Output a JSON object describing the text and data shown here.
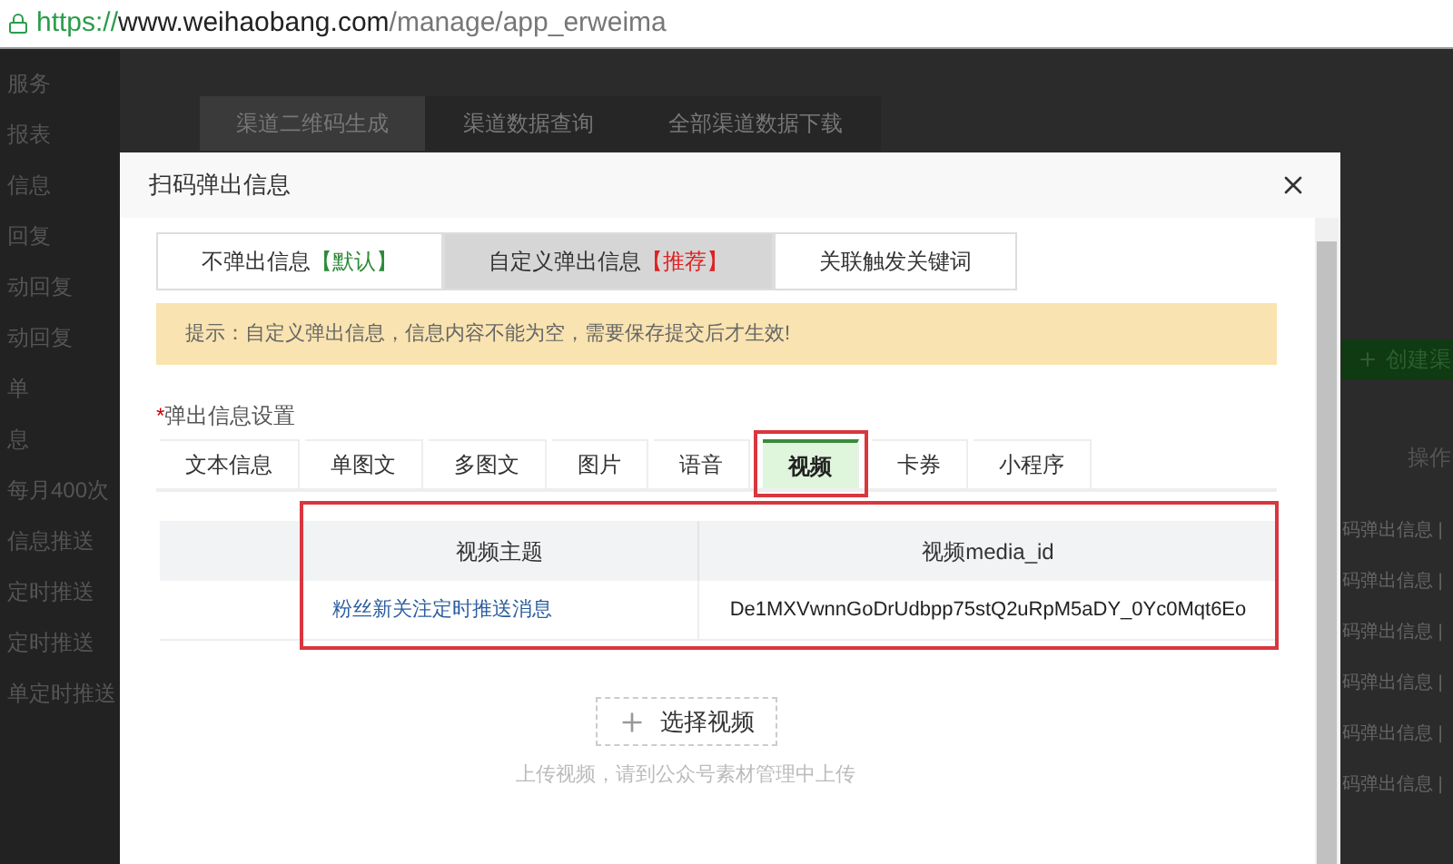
{
  "address_bar": {
    "scheme": "https://",
    "host": "www.weihaobang.com",
    "path": "/manage/app_erweima"
  },
  "sidebar": {
    "items": [
      "服务",
      "报表",
      "信息",
      "回复",
      "动回复",
      "动回复",
      "单",
      "息",
      "每月400次",
      "信息推送",
      "定时推送",
      "定时推送",
      "单定时推送"
    ]
  },
  "background_tabs": [
    {
      "label": "渠道二维码生成",
      "selected": true
    },
    {
      "label": "渠道数据查询",
      "selected": false
    },
    {
      "label": "全部渠道数据下载",
      "selected": false
    }
  ],
  "background_table": {
    "create_button": "创建渠",
    "column_header": "操作",
    "rows": [
      "码弹出信息 |",
      "码弹出信息 |",
      "码弹出信息 |",
      "码弹出信息 |",
      "码弹出信息 |",
      "码弹出信息 |"
    ]
  },
  "dialog": {
    "title": "扫码弹出信息",
    "modes": [
      {
        "label": "不弹出信息",
        "tag": "【默认】",
        "color": "#2e8b3a",
        "selected": false
      },
      {
        "label": "自定义弹出信息",
        "tag": "【推荐】",
        "color": "#e02020",
        "selected": true
      },
      {
        "label": "关联触发关键词",
        "selected": false
      }
    ],
    "notice": "提示：自定义弹出信息，信息内容不能为空，需要保存提交后才生效!",
    "section_label": {
      "required_mark": "*",
      "text": "弹出信息设置"
    },
    "type_tabs": [
      {
        "label": "文本信息",
        "selected": false
      },
      {
        "label": "单图文",
        "selected": false
      },
      {
        "label": "多图文",
        "selected": false
      },
      {
        "label": "图片",
        "selected": false
      },
      {
        "label": "语音",
        "selected": false
      },
      {
        "label": "视频",
        "selected": true
      },
      {
        "label": "卡券",
        "selected": false
      },
      {
        "label": "小程序",
        "selected": false
      }
    ],
    "table": {
      "columns": [
        "视频主题",
        "视频media_id"
      ],
      "rows": [
        {
          "title": "粉丝新关注定时推送消息",
          "media_id": "De1MXVwnnGoDrUdbpp75stQ2uRpM5aDY_0Yc0Mqt6Eo"
        }
      ]
    },
    "select_button": "选择视频",
    "hint": "上传视频，请到公众号素材管理中上传"
  }
}
